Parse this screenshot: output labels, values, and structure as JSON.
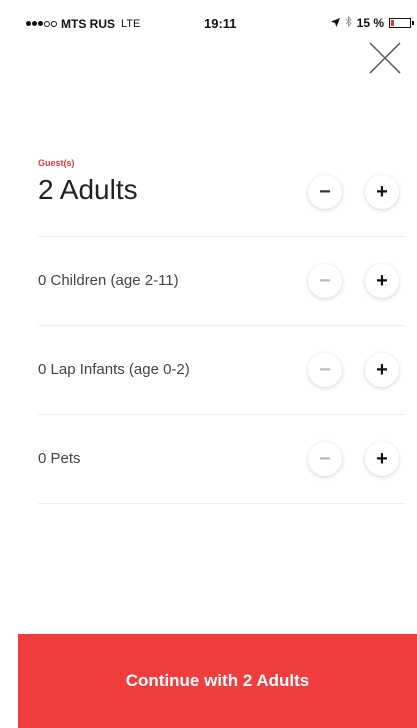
{
  "status_bar": {
    "carrier": "MTS RUS",
    "network": "LTE",
    "time": "19:11",
    "battery_percent": "15 %",
    "battery_level": 0.15,
    "icons": [
      "signal-dots-icon",
      "location-arrow-icon",
      "bluetooth-icon",
      "battery-icon"
    ]
  },
  "close": {
    "icon": "close-icon"
  },
  "guests": {
    "section_label": "Guest(s)",
    "adults_label": "2 Adults",
    "rows": [
      {
        "label": "0 Children (age 2-11)",
        "minus_enabled": false
      },
      {
        "label": "0 Lap Infants (age 0-2)",
        "minus_enabled": false
      },
      {
        "label": "0 Pets",
        "minus_enabled": false
      }
    ],
    "minus_symbol": "−",
    "plus_symbol": "+"
  },
  "footer": {
    "continue_label": "Continue with 2 Adults"
  },
  "colors": {
    "accent": "#f23d3f",
    "label_accent": "#e8393d"
  }
}
